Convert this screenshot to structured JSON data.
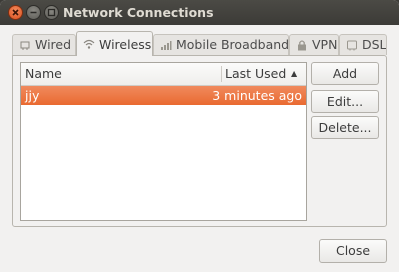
{
  "window": {
    "title": "Network Connections"
  },
  "tabs": [
    {
      "label": "Wired",
      "icon": "wired-icon",
      "active": false
    },
    {
      "label": "Wireless",
      "icon": "wireless-icon",
      "active": true
    },
    {
      "label": "Mobile Broadband",
      "icon": "signal-bars-icon",
      "active": false
    },
    {
      "label": "VPN",
      "icon": "lock-icon",
      "active": false
    },
    {
      "label": "DSL",
      "icon": "dsl-icon",
      "active": false
    }
  ],
  "connections": {
    "columns": {
      "name": "Name",
      "last_used": "Last Used"
    },
    "sort_indicator": "▲",
    "rows": [
      {
        "name": "jjy",
        "last_used": "3 minutes ago",
        "selected": true
      }
    ]
  },
  "actions": {
    "add": "Add",
    "edit": "Edit...",
    "delete": "Delete..."
  },
  "footer": {
    "close": "Close"
  },
  "colors": {
    "selection": "#e96a31",
    "titlebar": "#3c3b37",
    "close_button": "#e25a25"
  }
}
